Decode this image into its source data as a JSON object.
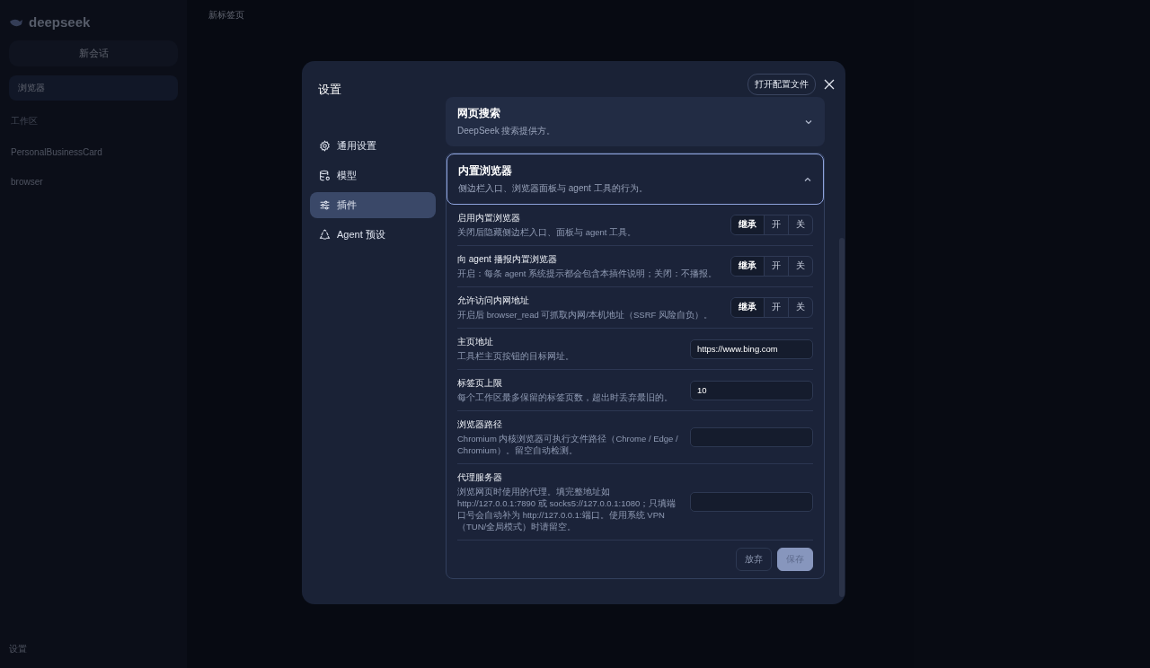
{
  "app": {
    "logo": "deepseek",
    "new_chat": "新会话",
    "nav_item": "浏览器",
    "workspace_label": "工作区",
    "workspaces": [
      "PersonalBusinessCard",
      "browser"
    ],
    "tab": "新标签页",
    "settings": "设置"
  },
  "dialog": {
    "title": "设置",
    "open_config": "打开配置文件",
    "nav": [
      {
        "label": "通用设置",
        "selected": false
      },
      {
        "label": "模型",
        "selected": false
      },
      {
        "label": "插件",
        "selected": true
      },
      {
        "label": "Agent 预设",
        "selected": false
      }
    ],
    "sections": [
      {
        "title": "网页搜索",
        "description": "DeepSeek 搜索提供方。",
        "expanded": false
      },
      {
        "title": "内置浏览器",
        "description": "侧边栏入口、浏览器面板与 agent 工具的行为。",
        "expanded": true,
        "rows": [
          {
            "kind": "toggle",
            "label": "启用内置浏览器",
            "description": "关闭后隐藏侧边栏入口、面板与 agent 工具。",
            "options": [
              {
                "label": "继承",
                "selected": true
              },
              {
                "label": "开",
                "selected": false
              },
              {
                "label": "关",
                "selected": false
              }
            ]
          },
          {
            "kind": "toggle",
            "label": "向 agent 播报内置浏览器",
            "description": "开启：每条 agent 系统提示都会包含本插件说明；关闭：不播报。",
            "options": [
              {
                "label": "继承",
                "selected": true
              },
              {
                "label": "开",
                "selected": false
              },
              {
                "label": "关",
                "selected": false
              }
            ]
          },
          {
            "kind": "toggle",
            "label": "允许访问内网地址",
            "description": "开启后 browser_read 可抓取内网/本机地址（SSRF 风险自负）。",
            "options": [
              {
                "label": "继承",
                "selected": true
              },
              {
                "label": "开",
                "selected": false
              },
              {
                "label": "关",
                "selected": false
              }
            ]
          },
          {
            "kind": "input",
            "label": "主页地址",
            "description": "工具栏主页按钮的目标网址。",
            "value": "https://www.bing.com"
          },
          {
            "kind": "input",
            "label": "标签页上限",
            "description": "每个工作区最多保留的标签页数，超出时丢弃最旧的。",
            "value": "10"
          },
          {
            "kind": "input",
            "label": "浏览器路径",
            "description": "Chromium 内核浏览器可执行文件路径（Chrome / Edge / Chromium）。留空自动检测。"
          },
          {
            "kind": "input",
            "label": "代理服务器",
            "description": "浏览网页时使用的代理。填完整地址如 http://127.0.0.1:7890 或 socks5://127.0.0.1:1080；只填端口号会自动补为 http://127.0.0.1:端口。使用系统 VPN（TUN/全局模式）时请留空。"
          }
        ],
        "buttons": [
          {
            "label": "放弃",
            "kind": "secondary"
          },
          {
            "label": "保存",
            "kind": "primary"
          }
        ]
      }
    ]
  }
}
